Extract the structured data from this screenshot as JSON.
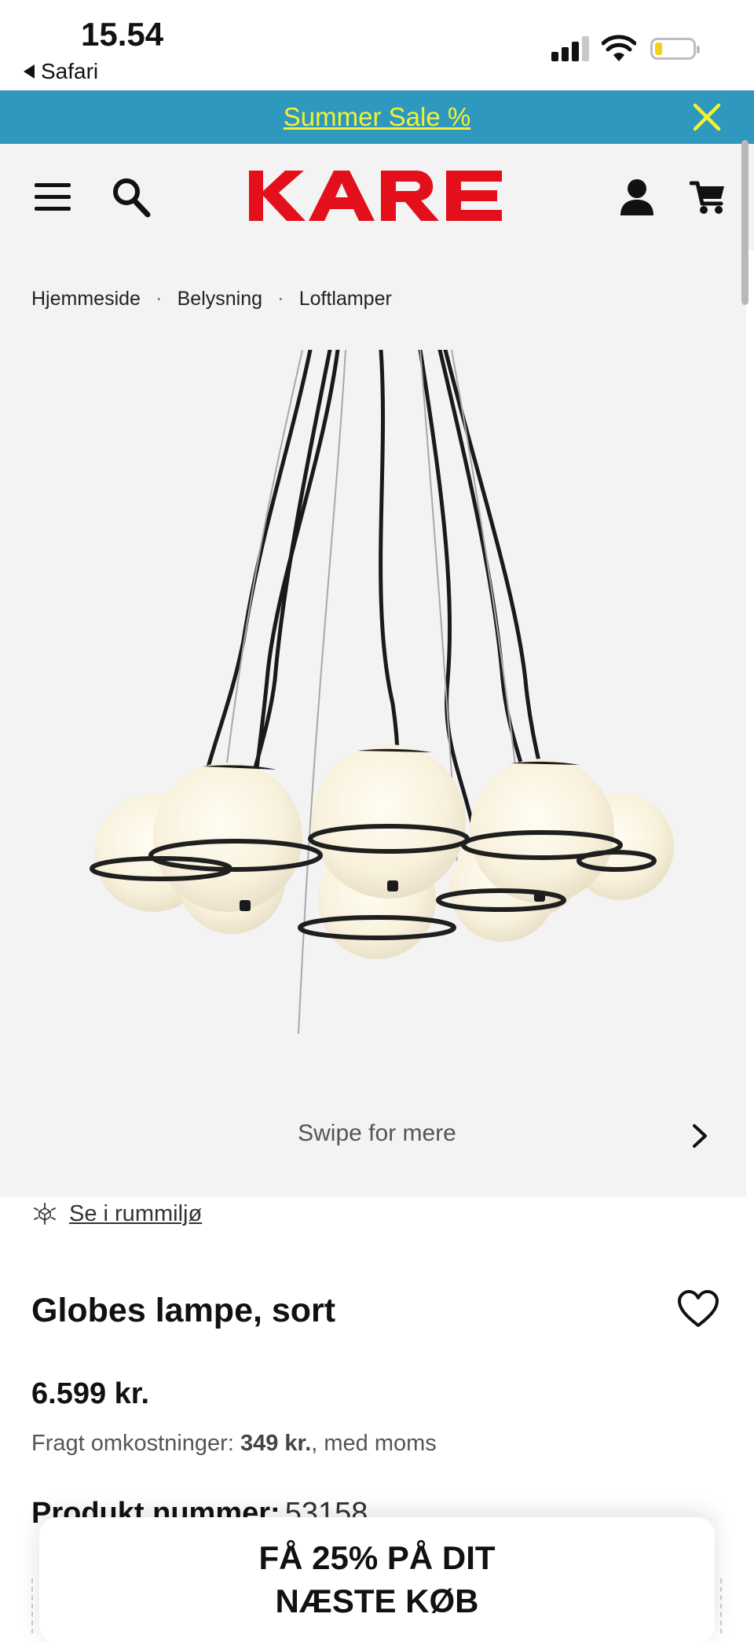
{
  "status_bar": {
    "time": "15.54",
    "back_app": "Safari"
  },
  "promo": {
    "text": "Summer Sale %",
    "text_color": "#f4f22f",
    "bar_color": "#2e98bf"
  },
  "header": {
    "logo": "KARE",
    "logo_color": "#e3101c"
  },
  "breadcrumb": [
    {
      "label": "Hjemmeside"
    },
    {
      "label": "Belysning"
    },
    {
      "label": "Loftlamper"
    }
  ],
  "gallery": {
    "swipe_hint": "Swipe for mere"
  },
  "room_view": {
    "label": "Se i rummiljø"
  },
  "product": {
    "title": "Globes lampe, sort",
    "price": "6.599 kr.",
    "shipping_label": "Fragt omkostninger:",
    "shipping_value": "349 kr.",
    "shipping_suffix": ", med moms",
    "number_label": "Produkt nummer:",
    "number_value": "53158"
  },
  "popup": {
    "line1": "FÅ 25% PÅ DIT",
    "line2": "NÆSTE KØB"
  }
}
